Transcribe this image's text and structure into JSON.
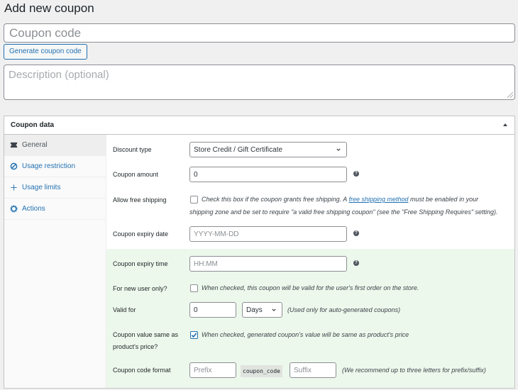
{
  "page_title": "Add new coupon",
  "coupon_code_placeholder": "Coupon code",
  "generate_button": "Generate coupon code",
  "description_placeholder": "Description (optional)",
  "panel_title": "Coupon data",
  "tabs": [
    {
      "label": "General",
      "icon": "ticket-icon"
    },
    {
      "label": "Usage restriction",
      "icon": "block-icon"
    },
    {
      "label": "Usage limits",
      "icon": "plus-icon"
    },
    {
      "label": "Actions",
      "icon": "gear-icon"
    }
  ],
  "fields": {
    "discount_type": {
      "label": "Discount type",
      "value": "Store Credit / Gift Certificate"
    },
    "coupon_amount": {
      "label": "Coupon amount",
      "value": "0"
    },
    "free_shipping": {
      "label": "Allow free shipping",
      "text_before": "Check this box if the coupon grants free shipping. A ",
      "link": "free shipping method",
      "text_after": " must be enabled in your",
      "line2": "shipping zone and be set to require \"a valid free shipping coupon\" (see the \"Free Shipping Requires\" setting).",
      "checked": false
    },
    "expiry_date": {
      "label": "Coupon expiry date",
      "placeholder": "YYYY-MM-DD"
    },
    "expiry_time": {
      "label": "Coupon expiry time",
      "placeholder": "HH:MM"
    },
    "new_user": {
      "label": "For new user only?",
      "text": "When checked, this coupon will be valid for the user's first order on the store.",
      "checked": false
    },
    "valid_for": {
      "label": "Valid for",
      "value": "0",
      "unit": "Days",
      "note": "(Used only for auto-generated coupons)"
    },
    "same_as_price": {
      "label_line1": "Coupon value same as",
      "label_line2": "product's price?",
      "text": "When checked, generated coupon's value will be same as product's price",
      "checked": true
    },
    "code_format": {
      "label": "Coupon code format",
      "prefix_placeholder": "Prefix",
      "code": "coupon_code",
      "suffix_placeholder": "Suffix",
      "note": "(We recommend up to three letters for prefix/suffix)"
    }
  },
  "colors": {
    "accent": "#2271b1",
    "green_zone": "#edf8ec"
  }
}
